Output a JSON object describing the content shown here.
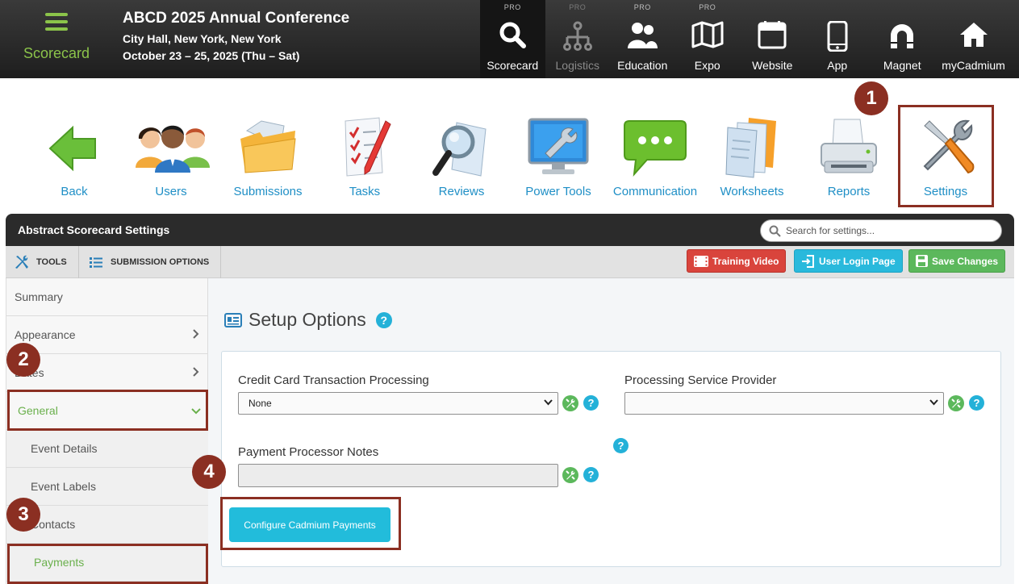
{
  "app": {
    "brand_label": "Scorecard",
    "conference_title": "ABCD 2025 Annual Conference",
    "location": "City Hall, New York, New York",
    "dates": "October 23 – 25, 2025 (Thu – Sat)"
  },
  "topnav": [
    {
      "label": "Scorecard",
      "pro": "PRO",
      "icon": "search-icon"
    },
    {
      "label": "Logistics",
      "pro": "PRO",
      "icon": "org-chart-icon"
    },
    {
      "label": "Education",
      "pro": "PRO",
      "icon": "people-icon"
    },
    {
      "label": "Expo",
      "pro": "PRO",
      "icon": "map-icon"
    },
    {
      "label": "Website",
      "icon": "browser-icon"
    },
    {
      "label": "App",
      "icon": "phone-icon"
    },
    {
      "label": "Magnet",
      "icon": "magnet-icon"
    },
    {
      "label": "myCadmium",
      "icon": "home-icon"
    }
  ],
  "toolbar": [
    {
      "label": "Back",
      "icon": "back-arrow-icon"
    },
    {
      "label": "Users",
      "icon": "users-icon"
    },
    {
      "label": "Submissions",
      "icon": "folder-icon"
    },
    {
      "label": "Tasks",
      "icon": "checklist-icon"
    },
    {
      "label": "Reviews",
      "icon": "magnifier-icon"
    },
    {
      "label": "Power Tools",
      "icon": "power-tools-icon"
    },
    {
      "label": "Communication",
      "icon": "chat-bubble-icon"
    },
    {
      "label": "Worksheets",
      "icon": "documents-icon"
    },
    {
      "label": "Reports",
      "icon": "printer-icon"
    },
    {
      "label": "Settings",
      "icon": "tools-icon"
    }
  ],
  "badges": [
    "1",
    "2",
    "3",
    "4"
  ],
  "panel": {
    "title": "Abstract Scorecard Settings",
    "search_placeholder": "Search for settings...",
    "tabs": {
      "tools": "TOOLS",
      "submission_options": "SUBMISSION OPTIONS"
    },
    "buttons": {
      "training_video": "Training Video",
      "user_login_page": "User Login Page",
      "save_changes": "Save Changes"
    }
  },
  "sidebar": {
    "summary": "Summary",
    "appearance": "Appearance",
    "dates": "Dates",
    "general": "General",
    "event_details": "Event Details",
    "event_labels": "Event Labels",
    "contacts": "Contacts",
    "payments": "Payments"
  },
  "main": {
    "title": "Setup Options",
    "help": "?",
    "cc_label": "Credit Card Transaction Processing",
    "cc_value": "None",
    "provider_label": "Processing Service Provider",
    "provider_value": "",
    "notes_label": "Payment Processor Notes",
    "notes_value": "",
    "configure_button": "Configure Cadmium Payments"
  },
  "colors": {
    "accent_green": "#8bc34a",
    "link_blue": "#1f8fc6",
    "highlight": "#8b2f22",
    "help_cyan": "#24b1d8"
  }
}
